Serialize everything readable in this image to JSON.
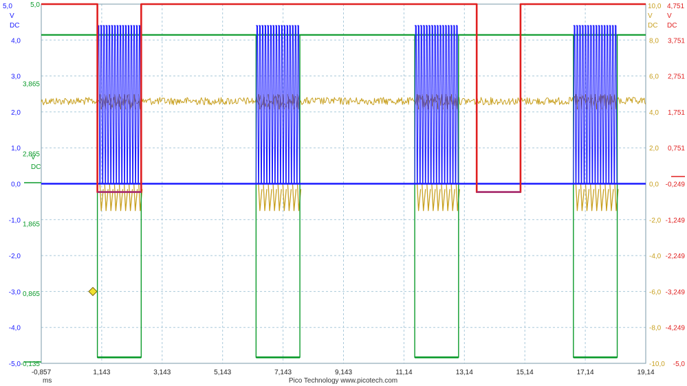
{
  "chart_data": {
    "type": "line",
    "footer": "Pico Technology   www.picotech.com",
    "x_unit": "ms",
    "x_ticks": [
      "-0,857",
      "1,143",
      "3,143",
      "5,143",
      "7,143",
      "9,143",
      "11,14",
      "13,14",
      "15,14",
      "17,14",
      "19,14"
    ],
    "xlim": [
      -0.857,
      19.143
    ],
    "grid": true,
    "axes": {
      "blue": {
        "color": "#1a1aff",
        "side": "left",
        "header": [
          "V",
          "DC"
        ],
        "top_label": "5,0",
        "ticks": [
          "4,0",
          "3,0",
          "2,0",
          "1,0",
          "0,0",
          "-1,0",
          "-2,0",
          "-3,0",
          "-4,0",
          "-5,0"
        ],
        "ylim": [
          -5.0,
          5.0
        ]
      },
      "green": {
        "color": "#0a9a2a",
        "side": "left",
        "header": [
          "V",
          "DC"
        ],
        "ticks": [
          "5,0",
          "3,865",
          "2,865",
          "1,865",
          "0,865",
          "-0,135"
        ],
        "values": [
          5.0,
          3.865,
          2.865,
          1.865,
          0.865,
          -0.135
        ],
        "ylim": [
          -0.135,
          5.0
        ]
      },
      "gold": {
        "color": "#c8a020",
        "side": "right",
        "header": [
          "V",
          "DC"
        ],
        "ticks": [
          "10,0",
          "8,0",
          "6,0",
          "4,0",
          "2,0",
          "0,0",
          "-2,0",
          "-4,0",
          "-6,0",
          "-8,0",
          "-10,0"
        ],
        "ylim": [
          -10.0,
          10.0
        ]
      },
      "red": {
        "color": "#e02020",
        "side": "right",
        "header": [
          "V",
          "DC"
        ],
        "ticks": [
          "4,751",
          "3,751",
          "2,751",
          "1,751",
          "0,751",
          "-0,249",
          "-1,249",
          "-2,249",
          "-3,249",
          "-4,249",
          "-5,0"
        ],
        "ylim": [
          -5.249,
          4.751
        ]
      }
    },
    "series": [
      {
        "key": "red",
        "axis": "red",
        "color": "#e02020",
        "high": 4.751,
        "low": -0.48,
        "low_intervals": [
          [
            1.0,
            2.45
          ],
          [
            13.55,
            15.0
          ]
        ]
      },
      {
        "key": "blue",
        "axis": "blue",
        "color": "#1a1aff",
        "idle": 0.0,
        "high": 4.4,
        "burst_intervals": [
          [
            1.0,
            2.45
          ],
          [
            6.25,
            7.7
          ],
          [
            11.5,
            12.95
          ],
          [
            16.75,
            18.2
          ]
        ],
        "pulses_per_burst": 16
      },
      {
        "key": "gold",
        "axis": "gold",
        "color": "#c8a020",
        "idle": 4.6,
        "burst_intervals": [
          [
            1.0,
            2.45
          ],
          [
            6.25,
            7.7
          ],
          [
            11.5,
            12.95
          ],
          [
            16.75,
            18.2
          ]
        ],
        "spike_low": -1.5
      },
      {
        "key": "green",
        "axis": "green",
        "color": "#0a9a2a",
        "high": 4.56,
        "low": -0.05,
        "low_intervals": [
          [
            1.0,
            2.45
          ],
          [
            6.25,
            7.7
          ],
          [
            11.5,
            12.95
          ],
          [
            16.75,
            18.2
          ]
        ]
      }
    ],
    "trigger": {
      "color": "#f0e030",
      "x": 0.85,
      "y_axis": "blue",
      "y": -3.0
    }
  }
}
